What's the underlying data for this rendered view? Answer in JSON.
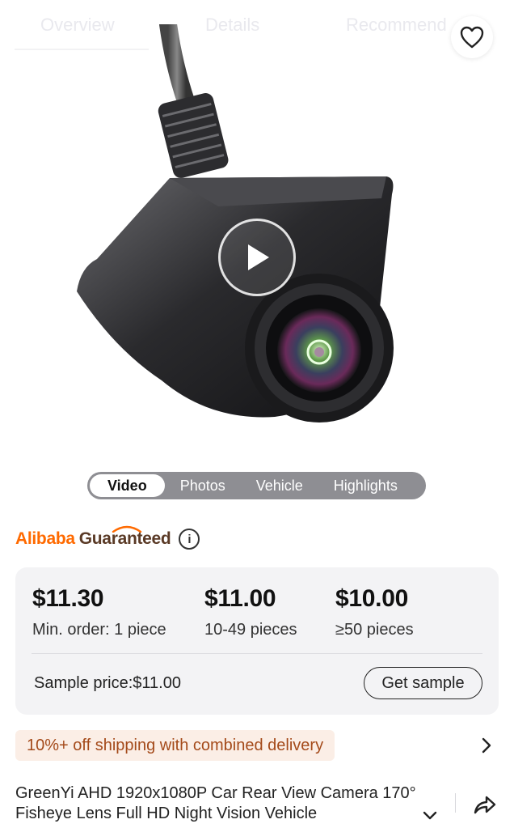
{
  "top_tabs": [
    "Overview",
    "Details",
    "Recommend"
  ],
  "media_tabs": {
    "items": [
      "Video",
      "Photos",
      "Vehicle",
      "Highlights"
    ],
    "active": "Video"
  },
  "guarantee": {
    "brand": "Alibaba",
    "label": "Guaranteed",
    "info_icon": "i"
  },
  "pricing": {
    "tiers": [
      {
        "price": "$11.30",
        "qty": "Min. order: 1 piece"
      },
      {
        "price": "$11.00",
        "qty": "10-49 pieces"
      },
      {
        "price": "$10.00",
        "qty": "≥50 pieces"
      }
    ],
    "sample_price": "Sample price:$11.00",
    "sample_button": "Get sample"
  },
  "shipping_banner": "10%+ off shipping with combined delivery",
  "product_title": "GreenYi AHD 1920x1080P Car Rear View Camera 170° Fisheye Lens Full HD Night Vision Vehicle",
  "icons": {
    "favorite": "heart-icon",
    "play": "play-icon",
    "info": "info-icon",
    "shipping_arrow": "chevron-right-icon",
    "expand": "chevron-down-icon",
    "share": "share-icon"
  },
  "colors": {
    "alibaba_orange": "#ff6a00",
    "guaranteed_brown": "#5a3a26",
    "banner_bg": "#fbeee6",
    "banner_text": "#a44a1a",
    "card_bg": "#f3f3f5",
    "segment_bg": "#8e8e93"
  }
}
